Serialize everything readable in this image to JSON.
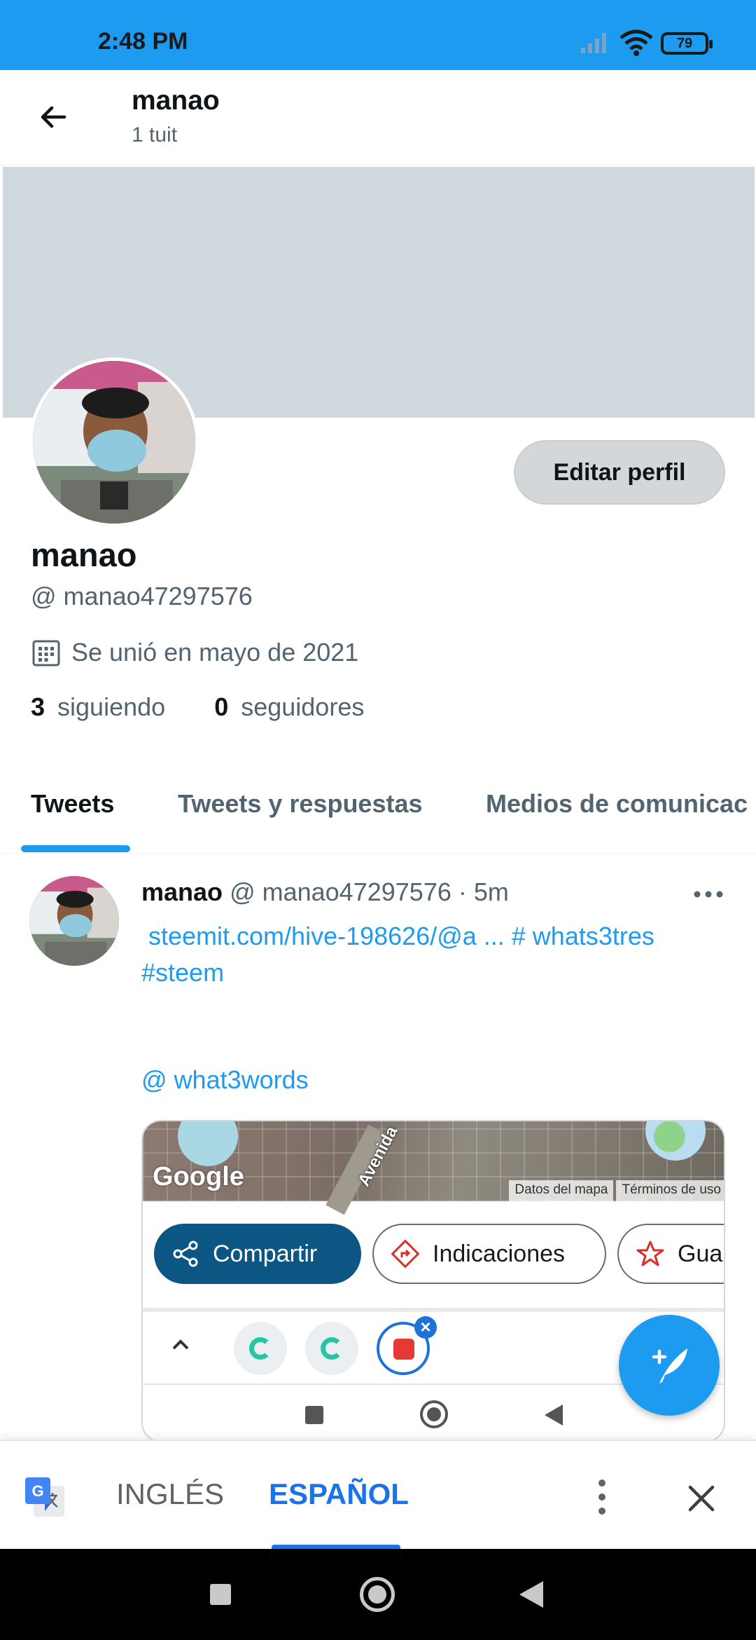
{
  "status_bar": {
    "time": "2:48 PM",
    "battery": "79"
  },
  "header": {
    "name": "manao",
    "tweet_count": "1 tuit"
  },
  "profile": {
    "edit_button": "Editar perfil",
    "name": "manao",
    "handle": "@ manao47297576",
    "joined": "Se unió en mayo de 2021",
    "following_count": "3",
    "following_label": "siguiendo",
    "followers_count": "0",
    "followers_label": "seguidores"
  },
  "tabs": [
    {
      "label": "Tweets",
      "active": true
    },
    {
      "label": "Tweets y respuestas",
      "active": false
    },
    {
      "label": "Medios de comunicac",
      "active": false
    }
  ],
  "tweet": {
    "author": "manao",
    "handle": "@ manao47297576",
    "separator": "·",
    "time": "5m",
    "text_line1": " steemit.com/hive-198626/@a ... # whats3tres",
    "text_line2": "#steem",
    "mention": "@ what3words",
    "media": {
      "street_label": "Avenida",
      "google_logo": "Google",
      "map_data": "Datos del mapa",
      "terms": "Términos de uso",
      "share": "Compartir",
      "directions": "Indicaciones",
      "save": "Gua"
    }
  },
  "translate_bar": {
    "source_lang": "INGLÉS",
    "target_lang": "ESPAÑOL"
  },
  "colors": {
    "accent": "#1d9bf0",
    "status_bar": "#1d9bf0",
    "banner": "#cfd9de",
    "translate_accent": "#1a73e8"
  }
}
